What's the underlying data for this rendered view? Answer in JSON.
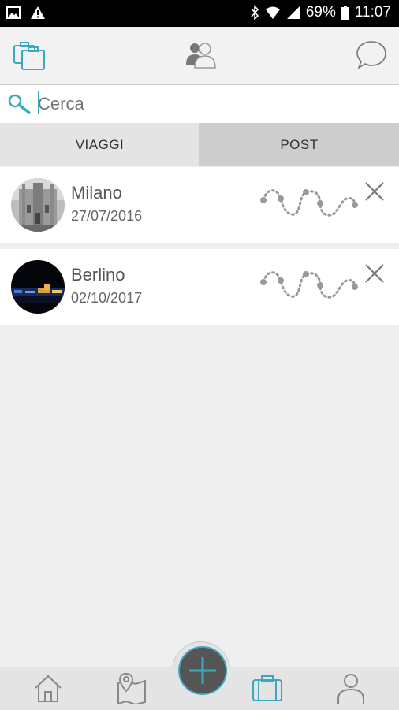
{
  "status_bar": {
    "battery_percent": "69%",
    "time": "11:07",
    "icons": [
      "image-icon",
      "warning-icon",
      "bluetooth-icon",
      "wifi-icon",
      "signal-icon",
      "battery-icon"
    ]
  },
  "top_bar": {
    "icons": [
      "suitcases-icon",
      "users-icon",
      "chat-bubble-icon"
    ],
    "accent_color": "#3aa9c0"
  },
  "search": {
    "placeholder": "Cerca",
    "value": ""
  },
  "tabs": [
    {
      "label": "VIAGGI",
      "active": true
    },
    {
      "label": "POST",
      "active": false
    }
  ],
  "trips": [
    {
      "city": "Milano",
      "date": "27/07/2016",
      "avatar": "milano-cathedral-photo"
    },
    {
      "city": "Berlino",
      "date": "02/10/2017",
      "avatar": "berlin-night-photo"
    }
  ],
  "bottom_nav": {
    "icons": [
      "home-icon",
      "map-pin-icon",
      "add-icon",
      "suitcase-icon",
      "profile-icon"
    ],
    "active": "suitcase-icon"
  }
}
